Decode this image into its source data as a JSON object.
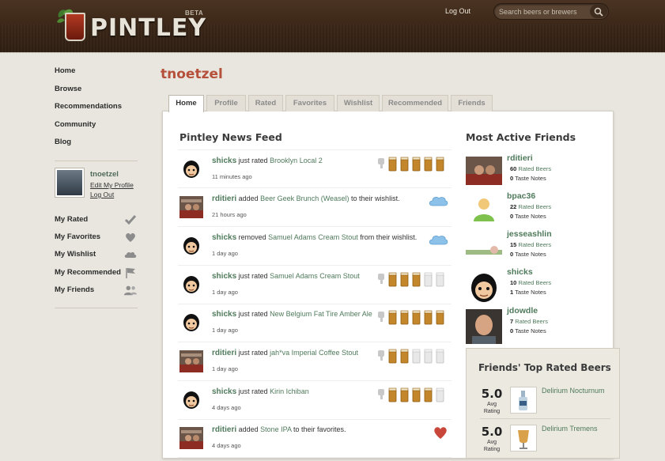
{
  "header": {
    "brand": "PINTLEY",
    "beta": "BETA",
    "logout": "Log Out",
    "search_placeholder": "Search beers or brewers"
  },
  "nav": {
    "items": [
      "Home",
      "Browse",
      "Recommendations",
      "Community",
      "Blog"
    ]
  },
  "profile": {
    "name": "tnoetzel",
    "edit": "Edit My Profile",
    "logout": "Log Out"
  },
  "mylinks": [
    {
      "label": "My Rated",
      "icon": "check-icon"
    },
    {
      "label": "My Favorites",
      "icon": "heart-icon"
    },
    {
      "label": "My Wishlist",
      "icon": "cloud-icon"
    },
    {
      "label": "My Recommended",
      "icon": "flag-icon"
    },
    {
      "label": "My Friends",
      "icon": "people-icon"
    }
  ],
  "page": {
    "title": "tnoetzel",
    "tabs": [
      "Home",
      "Profile",
      "Rated",
      "Favorites",
      "Wishlist",
      "Recommended",
      "Friends"
    ],
    "active_tab": "Home"
  },
  "feed": {
    "title": "Pintley News Feed",
    "items": [
      {
        "user": "shicks",
        "action": " just rated ",
        "beer": "Brooklyn Local 2",
        "suffix": "",
        "time": "11 minutes ago",
        "kind": "rating",
        "rating": 5,
        "avatar": "cartoon"
      },
      {
        "user": "rditieri",
        "action": " added ",
        "beer": "Beer Geek Brunch (Weasel)",
        "suffix": " to their wishlist.",
        "time": "21 hours ago",
        "kind": "wishlist",
        "avatar": "photo"
      },
      {
        "user": "shicks",
        "action": " removed ",
        "beer": "Samuel Adams Cream Stout",
        "suffix": " from their wishlist.",
        "time": "1 day ago",
        "kind": "wishlist",
        "avatar": "cartoon"
      },
      {
        "user": "shicks",
        "action": " just rated ",
        "beer": "Samuel Adams Cream Stout",
        "suffix": "",
        "time": "1 day ago",
        "kind": "rating",
        "rating": 3,
        "avatar": "cartoon"
      },
      {
        "user": "shicks",
        "action": " just rated ",
        "beer": "New Belgium Fat Tire Amber Ale",
        "suffix": "",
        "time": "1 day ago",
        "kind": "rating",
        "rating": 5,
        "avatar": "cartoon"
      },
      {
        "user": "rditieri",
        "action": " just rated ",
        "beer": "jah*va Imperial Coffee Stout",
        "suffix": "",
        "time": "1 day ago",
        "kind": "rating",
        "rating": 2,
        "avatar": "photo"
      },
      {
        "user": "shicks",
        "action": " just rated ",
        "beer": "Kirin Ichiban",
        "suffix": "",
        "time": "4 days ago",
        "kind": "rating",
        "rating": 4,
        "avatar": "cartoon"
      },
      {
        "user": "rditieri",
        "action": " added ",
        "beer": "Stone IPA",
        "suffix": " to their favorites.",
        "time": "4 days ago",
        "kind": "favorite",
        "avatar": "photo"
      }
    ]
  },
  "friends": {
    "title": "Most Active Friends",
    "rated_label": "Rated Beers",
    "notes_label": "Taste Notes",
    "items": [
      {
        "name": "rditieri",
        "rated": "60",
        "notes": "0",
        "avatar": "photo"
      },
      {
        "name": "bpac36",
        "rated": "22",
        "notes": "0",
        "avatar": "placeholder"
      },
      {
        "name": "jesseashlin",
        "rated": "15",
        "notes": "0",
        "avatar": "landscape"
      },
      {
        "name": "shicks",
        "rated": "10",
        "notes": "1",
        "avatar": "cartoon"
      },
      {
        "name": "jdowdle",
        "rated": "7",
        "notes": "0",
        "avatar": "photo2"
      }
    ]
  },
  "top_rated": {
    "title": "Friends' Top Rated Beers",
    "avg_label": "Avg",
    "rating_label": "Rating",
    "items": [
      {
        "score": "5.0",
        "name": "Delirium Nocturnum"
      },
      {
        "score": "5.0",
        "name": "Delirium Tremens"
      }
    ]
  },
  "colors": {
    "accent_red": "#b5503a",
    "link_green": "#4f7a5b",
    "header_brown": "#3a2617"
  }
}
